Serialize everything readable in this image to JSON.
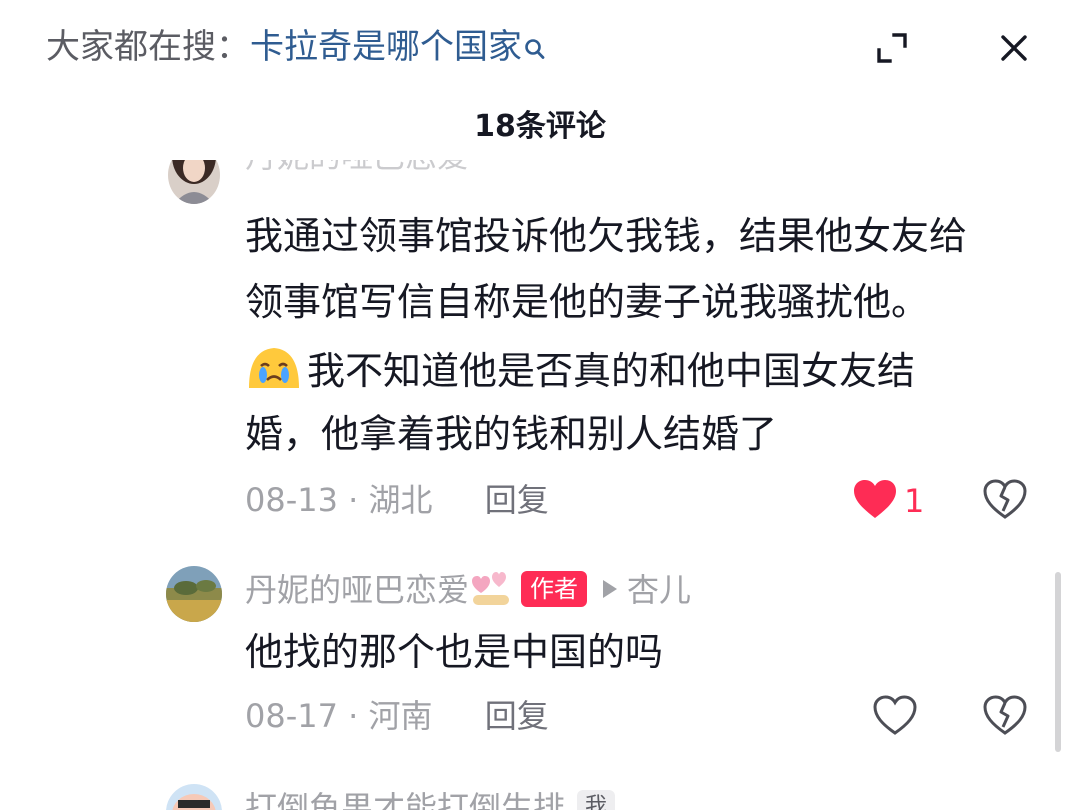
{
  "header": {
    "search_prefix": "大家都在搜：",
    "search_keyword": "卡拉奇是哪个国家",
    "comment_count_title": "18条评论"
  },
  "comments": [
    {
      "username_partial": "丹妮的哑巴恋爱",
      "lines": [
        "我通过领事馆投诉他欠我钱，结果他女友给",
        "领事馆写信自称是他的妻子说我骚扰他。",
        "我不知道他是否真的和他中国女友结",
        "婚，他拿着我的钱和别人结婚了"
      ],
      "emoji_icon": "crying-face-icon",
      "date": "08-13",
      "location": "湖北",
      "reply_label": "回复",
      "like_count": "1",
      "liked": true
    },
    {
      "username": "丹妮的哑巴恋爱",
      "author_badge": "作者",
      "reply_to": "杏儿",
      "text": "他找的那个也是中国的吗",
      "date": "08-17",
      "location": "河南",
      "reply_label": "回复",
      "liked": false
    },
    {
      "username": "打倒鱼果才能打倒生排",
      "me_badge": "我"
    }
  ],
  "meta_separator": "·",
  "colors": {
    "like_red": "#fe2c55",
    "keyword_blue": "#2f5c91",
    "meta_gray": "#a1a2a7"
  }
}
